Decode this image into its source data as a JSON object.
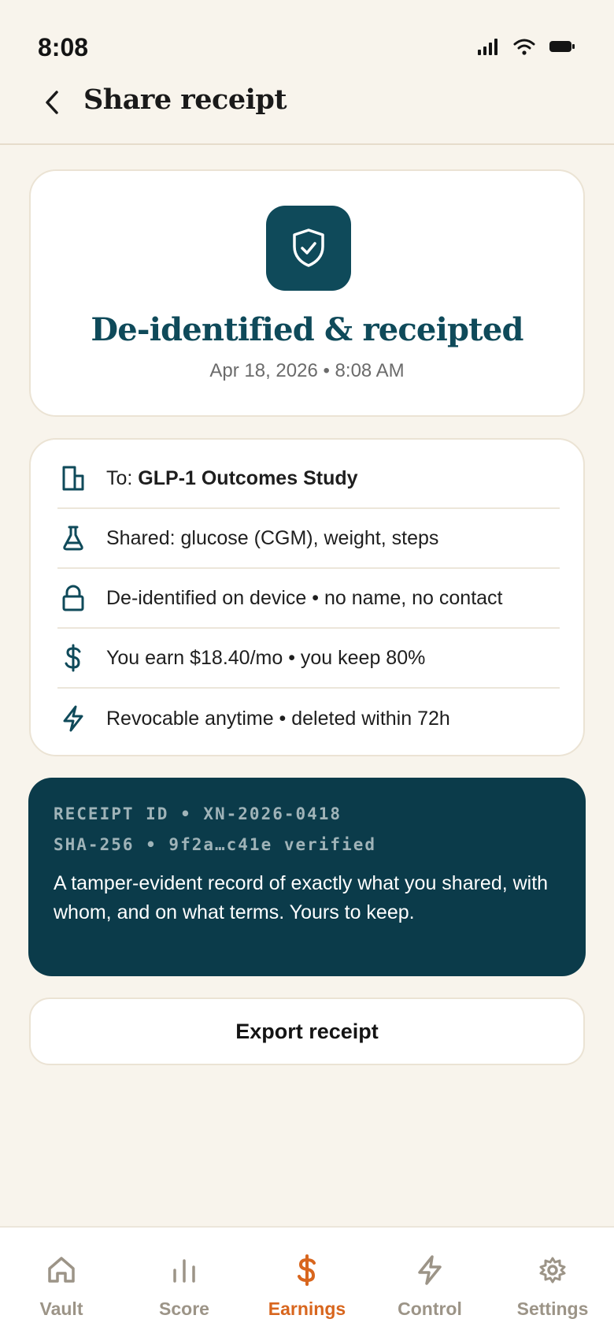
{
  "status_bar": {
    "time": "8:08"
  },
  "header": {
    "title": "Share receipt"
  },
  "hero": {
    "icon": "shield-check-icon",
    "title": "De-identified & receipted",
    "date": "Apr 18, 2026 • 8:08 AM"
  },
  "details": [
    {
      "icon": "building-icon",
      "prefix": "To: ",
      "text": "GLP-1 Outcomes Study"
    },
    {
      "icon": "flask-icon",
      "text": "Shared: glucose (CGM), weight, steps"
    },
    {
      "icon": "lock-icon",
      "text": "De-identified on device • no name, no contact"
    },
    {
      "icon": "dollar-icon",
      "text": "You earn $18.40/mo • you keep 80%"
    },
    {
      "icon": "bolt-icon",
      "text": "Revocable anytime • deleted within 72h"
    }
  ],
  "receipt": {
    "id_line": "RECEIPT ID • XN-2026-0418",
    "hash_line": "SHA-256 • 9f2a…c41e verified",
    "description": "A tamper-evident record of exactly what you shared, with whom, and on what terms. Yours to keep."
  },
  "export_label": "Export receipt",
  "tabs": [
    {
      "label": "Vault",
      "icon": "home-icon",
      "active": false
    },
    {
      "label": "Score",
      "icon": "bar-chart-icon",
      "active": false
    },
    {
      "label": "Earnings",
      "icon": "dollar-icon",
      "active": true
    },
    {
      "label": "Control",
      "icon": "bolt-icon",
      "active": false
    },
    {
      "label": "Settings",
      "icon": "gear-icon",
      "active": false
    }
  ],
  "colors": {
    "background": "#f8f4ec",
    "teal": "#0f4a5a",
    "dark_teal": "#0b3b4a",
    "accent": "#d8661e",
    "inactive_tab": "#9c9487"
  }
}
